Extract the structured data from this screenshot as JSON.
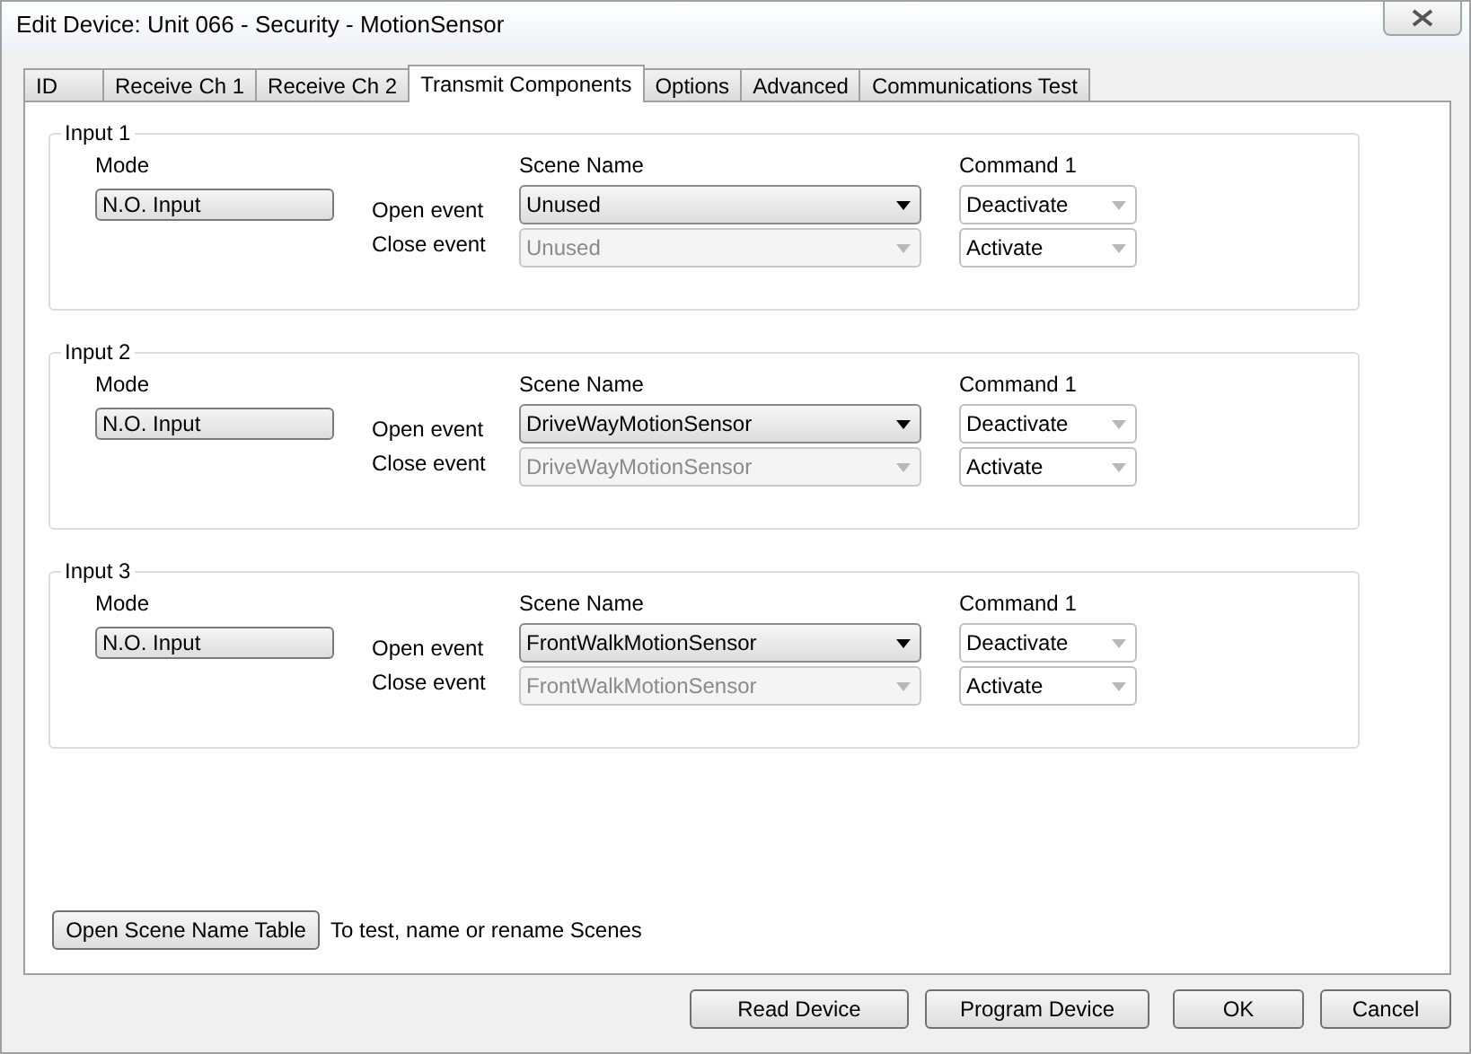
{
  "window": {
    "title": "Edit Device: Unit 066 - Security - MotionSensor"
  },
  "tabs": [
    {
      "label": "ID",
      "selected": false
    },
    {
      "label": "Receive Ch 1",
      "selected": false
    },
    {
      "label": "Receive Ch 2",
      "selected": false
    },
    {
      "label": "Transmit Components",
      "selected": true
    },
    {
      "label": "Options",
      "selected": false
    },
    {
      "label": "Advanced",
      "selected": false
    },
    {
      "label": "Communications Test",
      "selected": false
    }
  ],
  "inputs": [
    {
      "title": "Input 1",
      "mode_header": "Mode",
      "mode": "N.O. Input",
      "scene_header": "Scene Name",
      "command_header": "Command 1",
      "events": [
        {
          "label": "Open event",
          "scene": "Unused",
          "disabled": false,
          "command": "Deactivate"
        },
        {
          "label": "Close event",
          "scene": "Unused",
          "disabled": true,
          "command": "Activate"
        }
      ]
    },
    {
      "title": "Input 2",
      "mode_header": "Mode",
      "mode": "N.O. Input",
      "scene_header": "Scene Name",
      "command_header": "Command 1",
      "events": [
        {
          "label": "Open event",
          "scene": "DriveWayMotionSensor",
          "disabled": false,
          "command": "Deactivate"
        },
        {
          "label": "Close event",
          "scene": "DriveWayMotionSensor",
          "disabled": true,
          "command": "Activate"
        }
      ]
    },
    {
      "title": "Input 3",
      "mode_header": "Mode",
      "mode": "N.O. Input",
      "scene_header": "Scene Name",
      "command_header": "Command 1",
      "events": [
        {
          "label": "Open event",
          "scene": "FrontWalkMotionSensor",
          "disabled": false,
          "command": "Deactivate"
        },
        {
          "label": "Close event",
          "scene": "FrontWalkMotionSensor",
          "disabled": true,
          "command": "Activate"
        }
      ]
    }
  ],
  "scene_table_button": "Open Scene Name Table",
  "scene_table_hint": "To test, name or rename Scenes",
  "buttons": [
    "Read Device",
    "Program Device",
    "OK",
    "Cancel"
  ]
}
